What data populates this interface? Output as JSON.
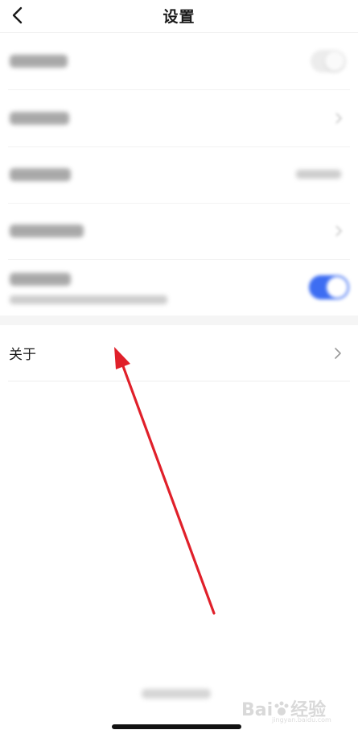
{
  "header": {
    "title": "设置",
    "back_icon": "chevron-left-icon"
  },
  "settings": {
    "obscured_rows": [
      {
        "control": "toggle",
        "state": "off"
      },
      {
        "control": "chevron"
      },
      {
        "control": "value-text"
      },
      {
        "control": "chevron"
      },
      {
        "control": "toggle",
        "state": "on",
        "has_subtitle": true
      }
    ],
    "about": {
      "label": "关于",
      "icon": "chevron-right-icon"
    }
  },
  "annotation": {
    "type": "arrow",
    "color": "#e0202a",
    "points_to": "about-row"
  },
  "watermark": {
    "text": "Bai",
    "text2": "经验",
    "sub": "jingyan.baidu.com"
  },
  "colors": {
    "accent": "#3d6df2",
    "annotation": "#e0202a"
  }
}
